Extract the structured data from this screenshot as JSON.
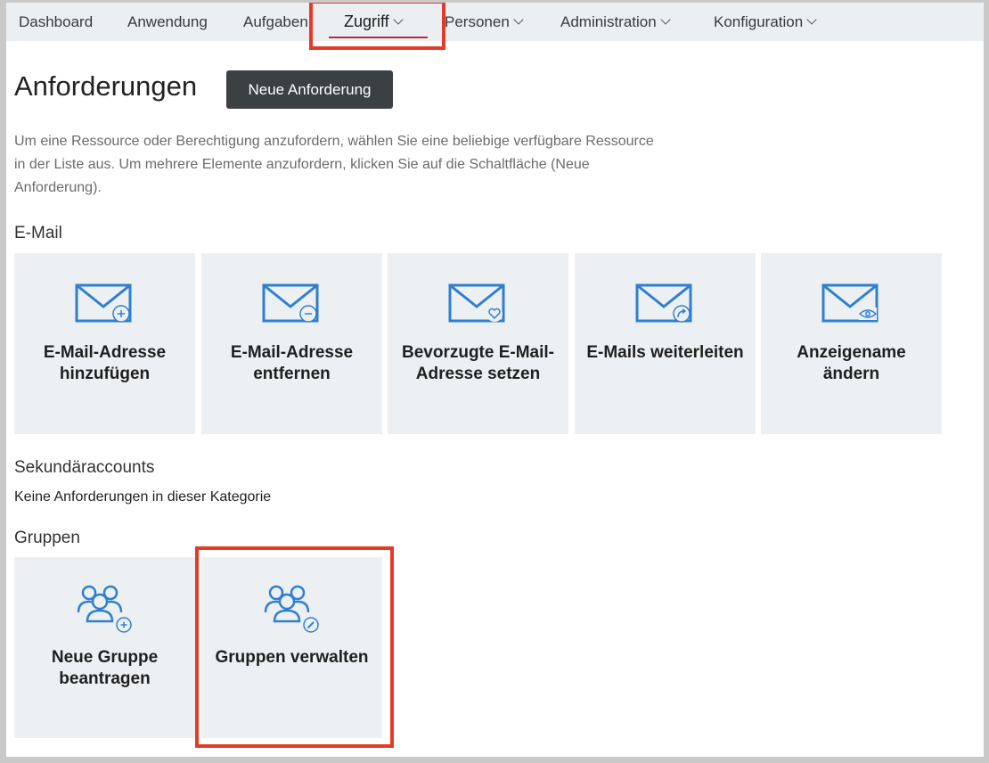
{
  "nav": {
    "items": [
      {
        "label": "Dashboard"
      },
      {
        "label": "Anwendung"
      },
      {
        "label": "Aufgaben"
      },
      {
        "label": "Zugriff"
      },
      {
        "label": "Personen"
      },
      {
        "label": "Administration"
      },
      {
        "label": "Konfiguration"
      }
    ],
    "active": "Zugriff"
  },
  "page": {
    "title": "Anforderungen",
    "new_request_button": "Neue Anforderung",
    "intro": "Um eine Ressource oder Berechtigung anzufordern, wählen Sie eine beliebige verfügbare Ressource in der Liste aus. Um mehrere Elemente anzufordern, klicken Sie auf die Schaltfläche (Neue Anforderung)."
  },
  "sections": {
    "email": {
      "title": "E-Mail",
      "tiles": [
        {
          "label": "E-Mail-Adresse hinzufügen",
          "icon": "mail-plus-icon"
        },
        {
          "label": "E-Mail-Adresse entfernen",
          "icon": "mail-minus-icon"
        },
        {
          "label": "Bevorzugte E-Mail-Adresse setzen",
          "icon": "mail-heart-icon"
        },
        {
          "label": "E-Mails weiterleiten",
          "icon": "mail-forward-icon"
        },
        {
          "label": "Anzeigename ändern",
          "icon": "mail-eye-icon"
        }
      ]
    },
    "secondary": {
      "title": "Sekundäraccounts",
      "empty_text": "Keine Anforderungen in dieser Kategorie"
    },
    "groups": {
      "title": "Gruppen",
      "tiles": [
        {
          "label": "Neue Gruppe beantragen",
          "icon": "group-plus-icon"
        },
        {
          "label": "Gruppen verwalten",
          "icon": "group-edit-icon"
        }
      ]
    }
  },
  "colors": {
    "accent_blue": "#2f7fd1",
    "highlight_red": "#e53a27",
    "nav_underline": "#b5294b",
    "button_dark": "#3b4043",
    "tile_bg": "#edf0f2"
  }
}
